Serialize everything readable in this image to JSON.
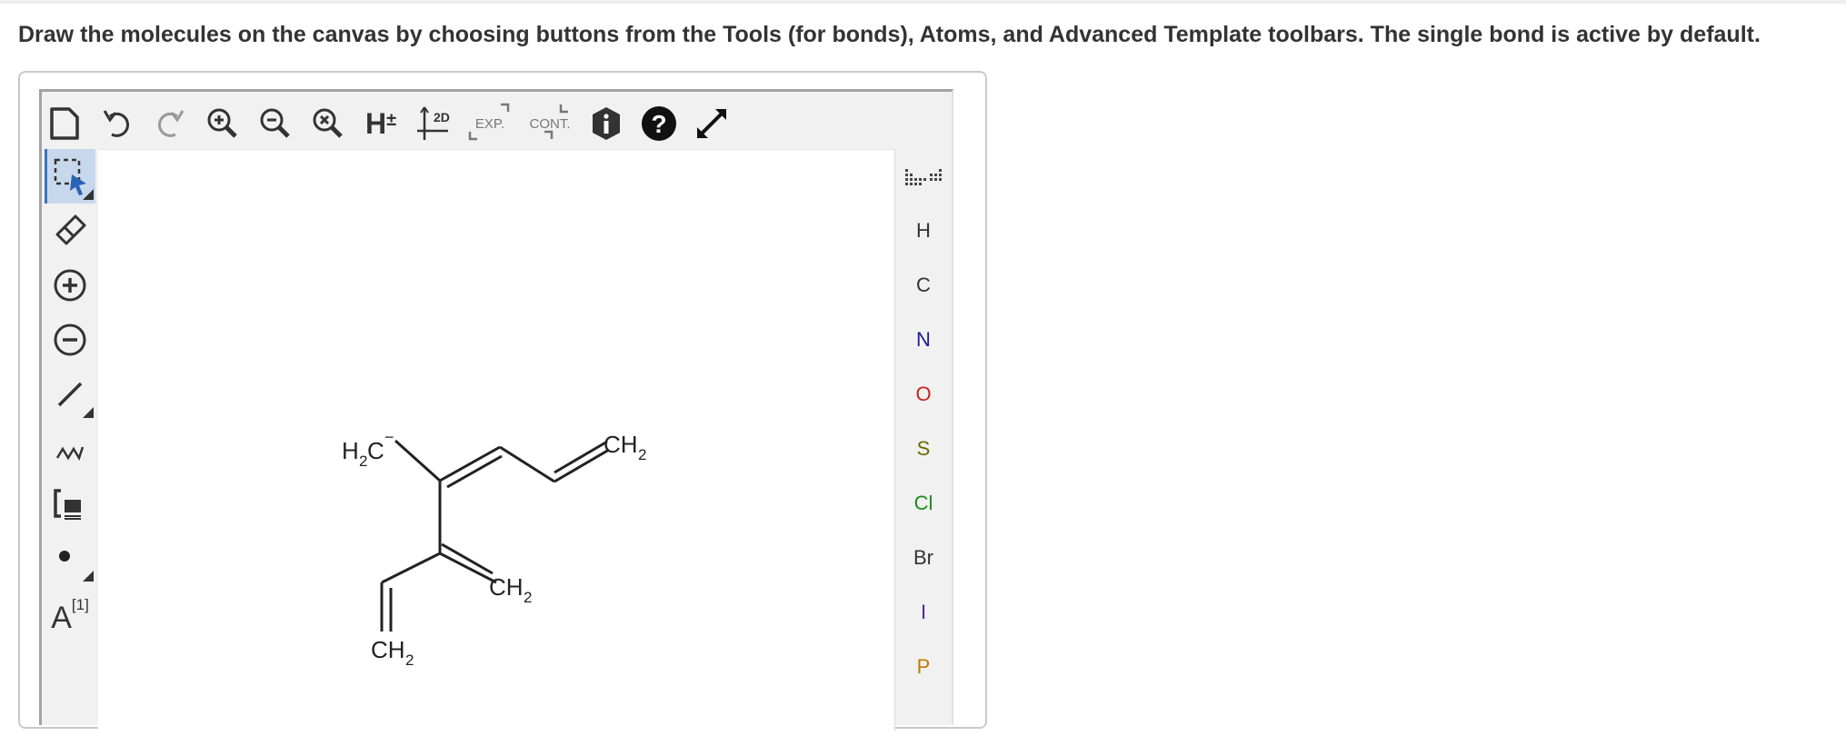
{
  "instructions": "Draw the molecules on the canvas by choosing buttons from the Tools (for bonds), Atoms, and Advanced Template toolbars. The single bond is active by default.",
  "top_toolbar": {
    "icons": [
      "new-document-icon",
      "undo-icon",
      "redo-icon",
      "zoom-in-icon",
      "zoom-out-icon",
      "zoom-reset-icon",
      "hydrogens-icon",
      "clean-2d-icon",
      "expand-icon",
      "contract-icon",
      "info-icon",
      "help-icon",
      "fullscreen-icon"
    ],
    "h_label": "H",
    "h_sup": "±",
    "clean_label": "2D",
    "expand_label": "EXP.",
    "contract_label": "CONT."
  },
  "left_toolbar": {
    "icons": [
      "selection-icon",
      "eraser-icon",
      "charge-plus-icon",
      "charge-minus-icon",
      "single-bond-icon",
      "chain-icon",
      "bracket-icon",
      "radical-icon",
      "atom-map-icon"
    ],
    "atom_map_label": "A",
    "atom_map_sup": "[1]"
  },
  "atoms": [
    {
      "symbol": "H",
      "color": "#333333"
    },
    {
      "symbol": "C",
      "color": "#333333"
    },
    {
      "symbol": "N",
      "color": "#1a1a9e"
    },
    {
      "symbol": "O",
      "color": "#cc1f1f"
    },
    {
      "symbol": "S",
      "color": "#6b6b00"
    },
    {
      "symbol": "Cl",
      "color": "#1a8a1a"
    },
    {
      "symbol": "Br",
      "color": "#333333"
    },
    {
      "symbol": "I",
      "color": "#5a1fa0"
    },
    {
      "symbol": "P",
      "color": "#c07a00"
    }
  ],
  "periodic_table_icon": "periodic-table-icon",
  "molecule": {
    "labels": {
      "h2c_H": "H",
      "h2c_sub": "2",
      "h2c_C": "C",
      "h2c_charge": "−",
      "ch2_right_C": "CH",
      "ch2_right_sub": "2",
      "ch2_mid_C": "CH",
      "ch2_mid_sub": "2",
      "ch2_bottom_C": "CH",
      "ch2_bottom_sub": "2"
    }
  }
}
